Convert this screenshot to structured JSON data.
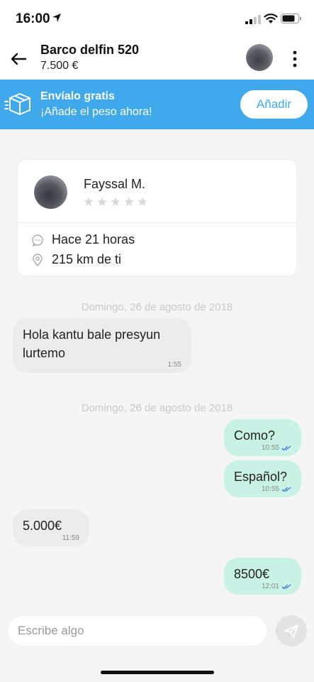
{
  "status_bar": {
    "time": "16:00",
    "icons": [
      "location-arrow-icon",
      "signal-icon",
      "wifi-icon",
      "battery-icon"
    ]
  },
  "header": {
    "title": "Barco delfin 520",
    "price": "7.500 €",
    "icons": [
      "back-arrow-icon",
      "more-vertical-icon"
    ]
  },
  "shipping_banner": {
    "title": "Envíalo gratis",
    "subtitle": "¡Añade el peso ahora!",
    "button_label": "Añadir",
    "icon": "package-box-icon",
    "background_color": "#3fa9ec"
  },
  "profile": {
    "name": "Fayssal M.",
    "rating": 0,
    "rating_max": 5,
    "last_seen": "Hace 21 horas",
    "distance": "215 km de ti",
    "icons": [
      "chat-bubble-icon",
      "location-pin-icon"
    ]
  },
  "chat": {
    "groups": [
      {
        "date": "Domingo, 26 de agosto de 2018",
        "messages": [
          {
            "direction": "in",
            "text": "Hola kantu bale presyun lurtemo",
            "time": "1:55"
          }
        ]
      },
      {
        "date": "Domingo, 26 de agosto de 2018",
        "messages": [
          {
            "direction": "out",
            "text": "Como?",
            "time": "10:55",
            "read": true
          },
          {
            "direction": "out",
            "text": "Español?",
            "time": "10:55",
            "read": true
          },
          {
            "direction": "in",
            "text": "5.000€",
            "time": "11:59"
          },
          {
            "direction": "out",
            "text": "8500€",
            "time": "12:01",
            "read": true
          }
        ]
      }
    ],
    "outgoing_bubble_color": "#c9f2e6",
    "incoming_bubble_color": "#ececec"
  },
  "composer": {
    "placeholder": "Escribe algo",
    "send_icon": "send-paper-plane-icon"
  }
}
